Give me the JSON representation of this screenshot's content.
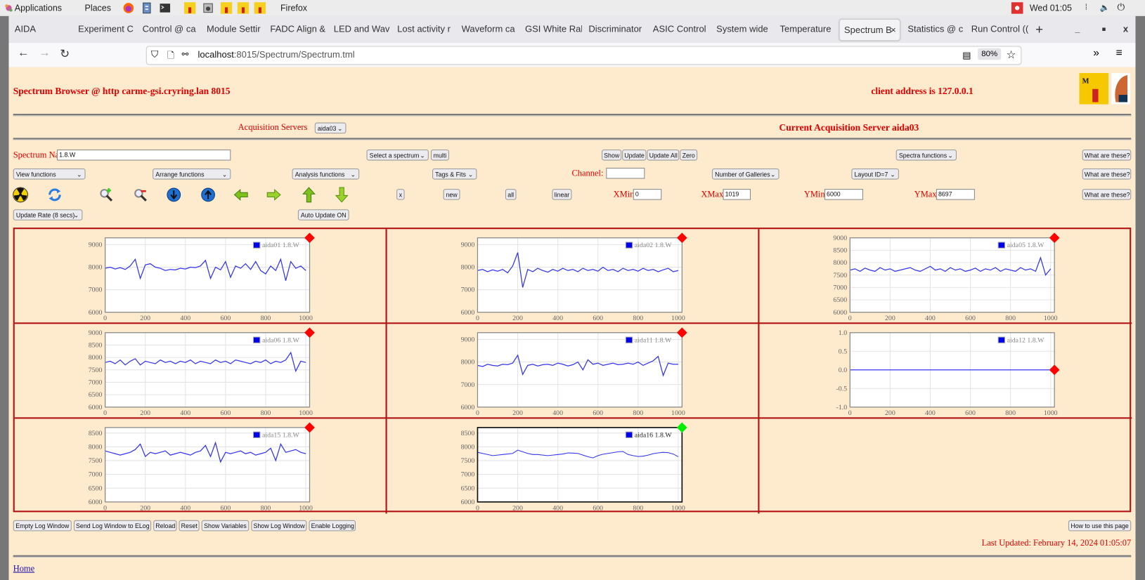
{
  "desktop": {
    "applications": "Applications",
    "places": "Places",
    "app_name": "Firefox",
    "clock": "Wed 01:05"
  },
  "browser": {
    "tabs": [
      {
        "label": "AIDA"
      },
      {
        "label": "Experiment C"
      },
      {
        "label": "Control @ ca"
      },
      {
        "label": "Module Settir"
      },
      {
        "label": "FADC Align &"
      },
      {
        "label": "LED and Wav"
      },
      {
        "label": "Lost activity r"
      },
      {
        "label": "Waveform ca"
      },
      {
        "label": "GSI White Ral"
      },
      {
        "label": "Discriminator"
      },
      {
        "label": "ASIC Control"
      },
      {
        "label": "System wide"
      },
      {
        "label": "Temperature"
      },
      {
        "label": "Spectrum B",
        "active": true
      },
      {
        "label": "Statistics @ c"
      },
      {
        "label": "Run Control (("
      }
    ],
    "url_host": "localhost",
    "url_rest": ":8015/Spectrum/Spectrum.tml",
    "zoom": "80%"
  },
  "page": {
    "title": "Spectrum Browser @ http carme-gsi.cryring.lan 8015",
    "client_address": "client address is 127.0.0.1",
    "logo_text": "Midas",
    "acq_servers_label": "Acquisition Servers",
    "acq_server_value": "aida03",
    "current_server": "Current Acquisition Server aida03",
    "spectrum_name_label": "Spectrum Name:",
    "spectrum_name_value": "1.8.W",
    "select_spectrum": "Select a spectrum",
    "multi": "multi",
    "show": "Show",
    "update": "Update",
    "update_all": "Update All",
    "zero": "Zero",
    "spectra_functions": "Spectra functions",
    "what": "What are these?",
    "view_functions": "View functions",
    "arrange_functions": "Arrange functions",
    "analysis_functions": "Analysis functions",
    "tags_fits": "Tags & Fits",
    "channel_label": "Channel:",
    "channel_value": "",
    "num_galleries": "Number of Galleries",
    "layout": "Layout ID=7",
    "x_btn": "x",
    "new_btn": "new",
    "all_btn": "all",
    "linear_btn": "linear",
    "xmin_label": "XMin",
    "xmin": "0",
    "xmax_label": "XMax",
    "xmax": "1019",
    "ymin_label": "YMin",
    "ymin": "6000",
    "ymax_label": "YMax",
    "ymax": "8697",
    "update_rate": "Update Rate (8 secs)",
    "auto_update": "Auto Update ON",
    "bottom_buttons": [
      "Empty Log Window",
      "Send Log Window to ELog",
      "Reload",
      "Reset",
      "Show Variables",
      "Show Log Window",
      "Enable Logging"
    ],
    "how_to": "How to use this page",
    "last_updated": "Last Updated: February 14, 2024 01:05:07",
    "home": "Home"
  },
  "colors": {
    "accent_red": "#e00000",
    "grid_border": "#b01010",
    "series": "#3333ee",
    "status_bad": "#ff0000",
    "status_good": "#00ee00"
  },
  "chart_data": [
    {
      "type": "line",
      "legend": "aida01 1.8.W",
      "status": "red",
      "xlim": [
        0,
        1019
      ],
      "ylim": [
        6000,
        9300
      ],
      "xticks": [
        "0",
        "200",
        "400",
        "600",
        "800",
        "1000"
      ],
      "yticks": [
        "6000",
        "7000",
        "8000",
        "9000"
      ],
      "grid": true,
      "legend_position": "top-right",
      "x": [
        0,
        25,
        50,
        75,
        100,
        125,
        150,
        175,
        200,
        225,
        250,
        275,
        300,
        325,
        350,
        375,
        400,
        425,
        450,
        475,
        500,
        525,
        550,
        575,
        600,
        625,
        650,
        675,
        700,
        725,
        750,
        775,
        800,
        825,
        850,
        875,
        900,
        925,
        950,
        975,
        1000
      ],
      "values": [
        7950,
        8000,
        7920,
        7980,
        7900,
        8050,
        8350,
        7500,
        8100,
        8150,
        8000,
        7950,
        7850,
        7900,
        7880,
        7950,
        7920,
        8000,
        7980,
        8050,
        8300,
        7500,
        8000,
        7880,
        8250,
        7550,
        8050,
        7950,
        8150,
        7900,
        8250,
        7850,
        7700,
        8050,
        7850,
        8350,
        7400,
        8250,
        7950,
        8050,
        7850
      ]
    },
    {
      "type": "line",
      "legend": "aida02 1.8.W",
      "status": "red",
      "xlim": [
        0,
        1019
      ],
      "ylim": [
        6000,
        9300
      ],
      "xticks": [
        "0",
        "200",
        "400",
        "600",
        "800",
        "1000"
      ],
      "yticks": [
        "6000",
        "7000",
        "8000",
        "9000"
      ],
      "grid": true,
      "legend_position": "top-right",
      "x": [
        0,
        25,
        50,
        75,
        100,
        125,
        150,
        175,
        200,
        225,
        250,
        275,
        300,
        325,
        350,
        375,
        400,
        425,
        450,
        475,
        500,
        525,
        550,
        575,
        600,
        625,
        650,
        675,
        700,
        725,
        750,
        775,
        800,
        825,
        850,
        875,
        900,
        925,
        950,
        975,
        1000
      ],
      "values": [
        7850,
        7900,
        7800,
        7880,
        7820,
        7900,
        7750,
        8050,
        8650,
        7100,
        7900,
        7800,
        7950,
        7850,
        7780,
        7900,
        7820,
        7950,
        7850,
        7900,
        7800,
        7950,
        7850,
        7900,
        7820,
        8000,
        7850,
        7900,
        7800,
        7950,
        7850,
        7900,
        7820,
        7950,
        7850,
        7900,
        7800,
        7880,
        7950,
        7800,
        7850
      ]
    },
    {
      "type": "line",
      "legend": "aida05 1.8.W",
      "status": "red",
      "xlim": [
        0,
        1019
      ],
      "ylim": [
        6000,
        9000
      ],
      "xticks": [
        "0",
        "200",
        "400",
        "600",
        "800",
        "1000"
      ],
      "yticks": [
        "6000",
        "6500",
        "7000",
        "7500",
        "8000",
        "8500",
        "9000"
      ],
      "grid": true,
      "legend_position": "top-right",
      "x": [
        0,
        25,
        50,
        75,
        100,
        125,
        150,
        175,
        200,
        225,
        250,
        275,
        300,
        325,
        350,
        375,
        400,
        425,
        450,
        475,
        500,
        525,
        550,
        575,
        600,
        625,
        650,
        675,
        700,
        725,
        750,
        775,
        800,
        825,
        850,
        875,
        900,
        925,
        950,
        975,
        1000
      ],
      "values": [
        7700,
        7750,
        7650,
        7780,
        7700,
        7650,
        7800,
        7700,
        7750,
        7650,
        7700,
        7750,
        7800,
        7700,
        7650,
        7750,
        7850,
        7700,
        7750,
        7650,
        7800,
        7700,
        7750,
        7650,
        7700,
        7780,
        7650,
        7750,
        7700,
        7800,
        7650,
        7750,
        7700,
        7650,
        7800,
        7700,
        7750,
        7650,
        8200,
        7500,
        7750
      ]
    },
    {
      "type": "line",
      "legend": "aida06 1.8.W",
      "status": "red",
      "xlim": [
        0,
        1019
      ],
      "ylim": [
        6000,
        9000
      ],
      "xticks": [
        "0",
        "200",
        "400",
        "600",
        "800",
        "1000"
      ],
      "yticks": [
        "6000",
        "6500",
        "7000",
        "7500",
        "8000",
        "8500",
        "9000"
      ],
      "grid": true,
      "legend_position": "top-right",
      "x": [
        0,
        25,
        50,
        75,
        100,
        125,
        150,
        175,
        200,
        225,
        250,
        275,
        300,
        325,
        350,
        375,
        400,
        425,
        450,
        475,
        500,
        525,
        550,
        575,
        600,
        625,
        650,
        675,
        700,
        725,
        750,
        775,
        800,
        825,
        850,
        875,
        900,
        925,
        950,
        975,
        1000
      ],
      "values": [
        7800,
        7850,
        7750,
        7900,
        7700,
        7850,
        7950,
        7700,
        7850,
        7800,
        7750,
        7900,
        7800,
        7850,
        7750,
        7850,
        7800,
        7900,
        7750,
        7850,
        7800,
        7750,
        7900,
        7800,
        7850,
        7750,
        7900,
        7850,
        7800,
        7750,
        7850,
        7800,
        7900,
        7750,
        7850,
        7800,
        7900,
        8200,
        7450,
        7850,
        7800
      ]
    },
    {
      "type": "line",
      "legend": "aida11 1.8.W",
      "status": "red",
      "xlim": [
        0,
        1019
      ],
      "ylim": [
        6000,
        9300
      ],
      "xticks": [
        "0",
        "200",
        "400",
        "600",
        "800",
        "1000"
      ],
      "yticks": [
        "6000",
        "7000",
        "8000",
        "9000"
      ],
      "grid": true,
      "legend_position": "top-right",
      "x": [
        0,
        25,
        50,
        75,
        100,
        125,
        150,
        175,
        200,
        225,
        250,
        275,
        300,
        325,
        350,
        375,
        400,
        425,
        450,
        475,
        500,
        525,
        550,
        575,
        600,
        625,
        650,
        675,
        700,
        725,
        750,
        775,
        800,
        825,
        850,
        875,
        900,
        925,
        950,
        975,
        1000
      ],
      "values": [
        7850,
        7800,
        7900,
        7850,
        7820,
        7900,
        7880,
        7950,
        8300,
        7450,
        7850,
        7900,
        7820,
        7880,
        7900,
        7850,
        7950,
        7900,
        7820,
        7880,
        8000,
        7650,
        8100,
        7900,
        7950,
        7850,
        7900,
        7950,
        7880,
        7900,
        7950,
        7900,
        8000,
        7850,
        7950,
        8050,
        8250,
        7400,
        7950,
        7900,
        7900
      ]
    },
    {
      "type": "line",
      "legend": "aida12 1.8.W",
      "status": "red",
      "xlim": [
        0,
        1019
      ],
      "ylim": [
        -1,
        1
      ],
      "xticks": [
        "0",
        "200",
        "400",
        "600",
        "800",
        "1000"
      ],
      "yticks": [
        "-1.0",
        "-0.5",
        "0.0",
        "0.5",
        "1.0"
      ],
      "grid": true,
      "legend_position": "top-right",
      "x": [
        0,
        1000
      ],
      "values": [
        0,
        0
      ]
    },
    {
      "type": "line",
      "legend": "aida15 1.8.W",
      "status": "red",
      "xlim": [
        0,
        1019
      ],
      "ylim": [
        6000,
        8700
      ],
      "xticks": [
        "0",
        "200",
        "400",
        "600",
        "800",
        "1000"
      ],
      "yticks": [
        "6000",
        "6500",
        "7000",
        "7500",
        "8000",
        "8500"
      ],
      "grid": true,
      "legend_position": "top-right",
      "x": [
        0,
        25,
        50,
        75,
        100,
        125,
        150,
        175,
        200,
        225,
        250,
        275,
        300,
        325,
        350,
        375,
        400,
        425,
        450,
        475,
        500,
        525,
        550,
        575,
        600,
        625,
        650,
        675,
        700,
        725,
        750,
        775,
        800,
        825,
        850,
        875,
        900,
        925,
        950,
        975,
        1000
      ],
      "values": [
        7850,
        7800,
        7750,
        7700,
        7750,
        7800,
        7900,
        8100,
        7650,
        7800,
        7750,
        7800,
        7850,
        7700,
        7750,
        7800,
        7750,
        7700,
        7800,
        7850,
        8050,
        7650,
        8150,
        7450,
        7800,
        7750,
        7800,
        7850,
        7750,
        7800,
        7700,
        7750,
        7800,
        7950,
        7500,
        8100,
        7800,
        7850,
        7900,
        7800,
        7750
      ]
    },
    {
      "type": "line",
      "legend": "aida16 1.8.W",
      "status": "green",
      "selected": true,
      "xlim": [
        0,
        1019
      ],
      "ylim": [
        6000,
        8700
      ],
      "xticks": [
        "0",
        "200",
        "400",
        "600",
        "800",
        "1000"
      ],
      "yticks": [
        "6000",
        "6500",
        "7000",
        "7500",
        "8000",
        "8500"
      ],
      "grid": true,
      "legend_position": "top-right",
      "x": [
        0,
        25,
        50,
        75,
        100,
        125,
        150,
        175,
        200,
        225,
        250,
        275,
        300,
        325,
        350,
        375,
        400,
        425,
        450,
        475,
        500,
        525,
        550,
        575,
        600,
        625,
        650,
        675,
        700,
        725,
        750,
        775,
        800,
        825,
        850,
        875,
        900,
        925,
        950,
        975,
        1000
      ],
      "values": [
        7800,
        7760,
        7720,
        7680,
        7700,
        7720,
        7740,
        7760,
        7880,
        7820,
        7760,
        7720,
        7720,
        7700,
        7680,
        7700,
        7720,
        7740,
        7780,
        7770,
        7760,
        7700,
        7640,
        7600,
        7680,
        7730,
        7760,
        7790,
        7820,
        7830,
        7720,
        7680,
        7650,
        7660,
        7700,
        7750,
        7780,
        7800,
        7790,
        7740,
        7640
      ]
    }
  ]
}
